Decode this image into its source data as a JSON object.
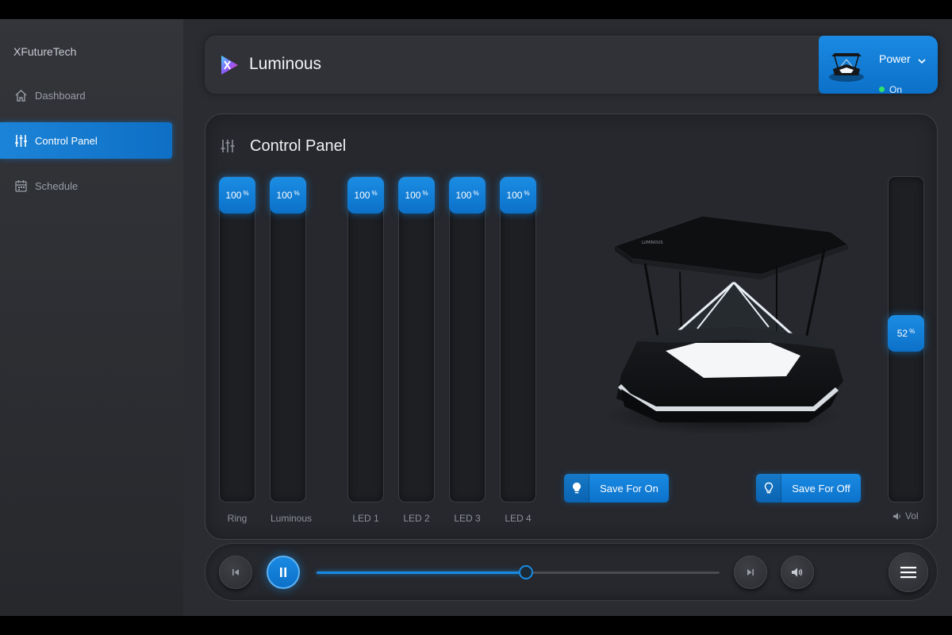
{
  "sidebar": {
    "brand": "XFutureTech",
    "items": [
      {
        "label": "Dashboard",
        "icon": "home-icon",
        "active": false
      },
      {
        "label": "Control Panel",
        "icon": "sliders-icon",
        "active": true
      },
      {
        "label": "Schedule",
        "icon": "calendar-icon",
        "active": false
      }
    ]
  },
  "header": {
    "title": "Luminous",
    "power": {
      "label": "Power",
      "status": "On"
    }
  },
  "panel": {
    "title": "Control Panel",
    "sliders": [
      {
        "label": "Ring",
        "value": "100",
        "unit": "%",
        "level": 1.0
      },
      {
        "label": "Luminous",
        "value": "100",
        "unit": "%",
        "level": 1.0
      },
      {
        "label": "LED 1",
        "value": "100",
        "unit": "%",
        "level": 1.0
      },
      {
        "label": "LED 2",
        "value": "100",
        "unit": "%",
        "level": 1.0
      },
      {
        "label": "LED 3",
        "value": "100",
        "unit": "%",
        "level": 1.0
      },
      {
        "label": "LED 4",
        "value": "100",
        "unit": "%",
        "level": 1.0
      }
    ],
    "save_on": "Save For On",
    "save_off": "Save For Off",
    "volume": {
      "label": "Vol",
      "value": "52",
      "unit": "%",
      "level": 0.52
    }
  },
  "player": {
    "progress": 0.52
  },
  "colors": {
    "accent": "#1a8ae3",
    "background": "#2a2c31",
    "panel": "#26282d",
    "power_on": "#2fe36a"
  }
}
